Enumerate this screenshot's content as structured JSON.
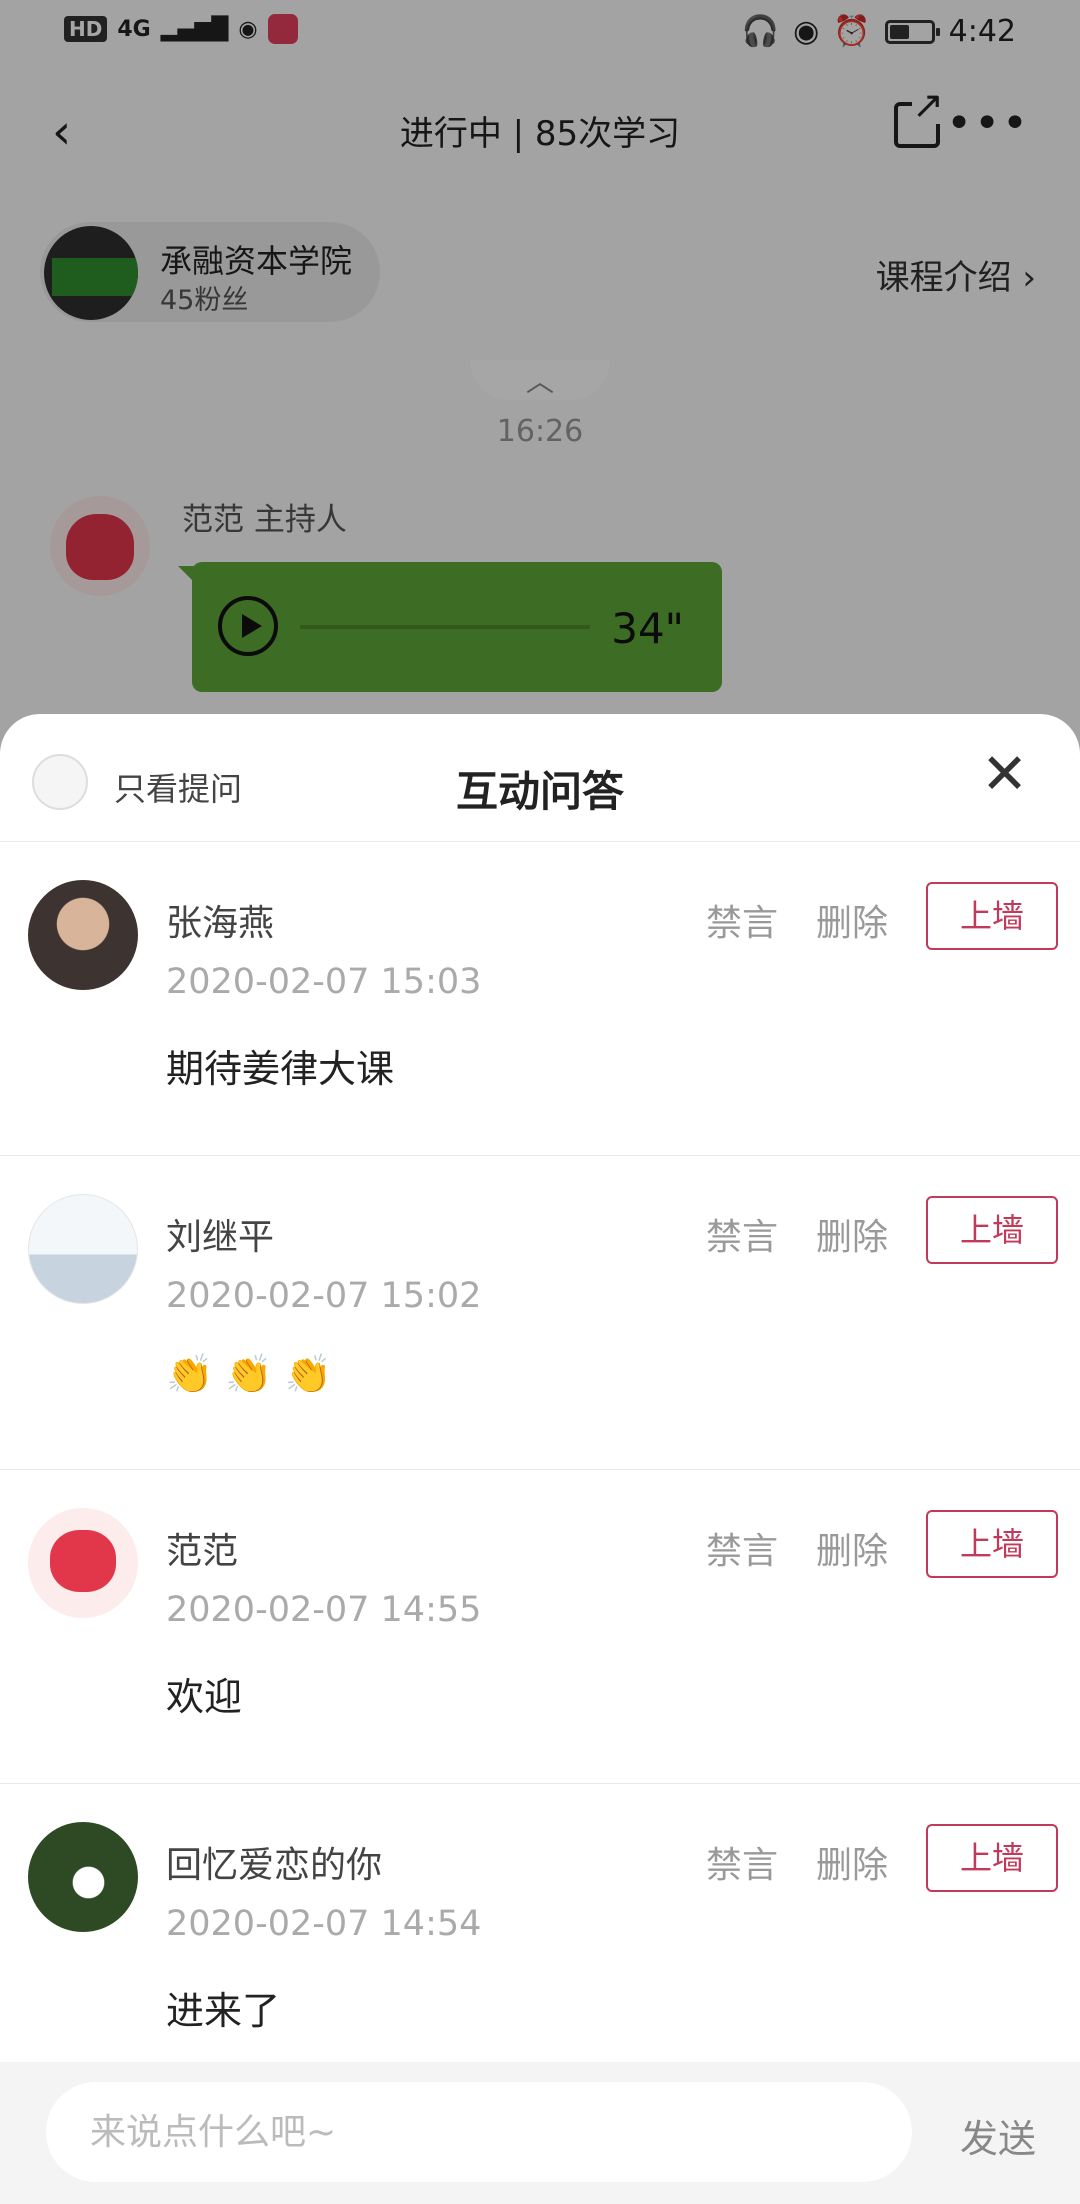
{
  "status_bar": {
    "left_text": "HD",
    "network": "4G",
    "time": "4:42"
  },
  "navbar": {
    "back_icon": "chevron-left-icon",
    "title": "进行中 | 85次学习",
    "share_icon": "share-icon",
    "more_icon": "more-icon"
  },
  "anchor": {
    "name": "承融资本学院",
    "fans": "45粉丝",
    "course_intro": "课程介绍 ›"
  },
  "chat": {
    "time": "16:26",
    "host_name": "范范 主持人",
    "voice_duration": "34\""
  },
  "sheet": {
    "only_questions_label": "只看提问",
    "title": "互动问答",
    "close_icon": "close-icon",
    "actions": {
      "mute": "禁言",
      "delete": "删除",
      "wall": "上墙"
    },
    "items": [
      {
        "name": "张海燕",
        "time": "2020-02-07 15:03",
        "text": "期待姜律大课"
      },
      {
        "name": "刘继平",
        "time": "2020-02-07 15:02",
        "text": "👏 👏 👏"
      },
      {
        "name": "范范",
        "time": "2020-02-07 14:55",
        "text": "欢迎"
      },
      {
        "name": "回忆爱恋的你",
        "time": "2020-02-07 14:54",
        "text": "进来了"
      }
    ]
  },
  "input": {
    "placeholder": "来说点什么吧~",
    "send_label": "发送"
  }
}
